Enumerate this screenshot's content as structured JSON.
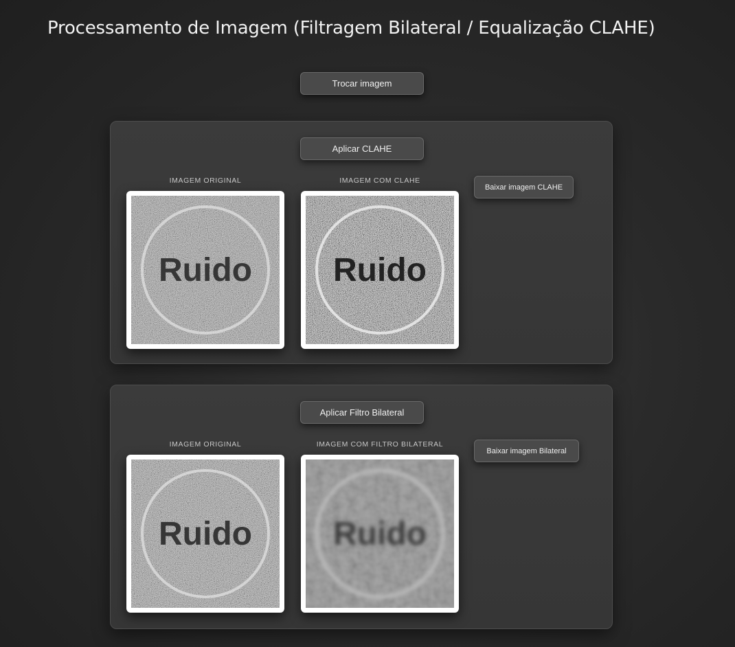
{
  "page": {
    "title": "Processamento de Imagem (Filtragem Bilateral / Equalização CLAHE)"
  },
  "toolbar": {
    "swap_label": "Trocar imagem"
  },
  "clahe_panel": {
    "apply_label": "Aplicar CLAHE",
    "original_label": "IMAGEM ORIGINAL",
    "result_label": "IMAGEM COM CLAHE",
    "download_label": "Baixar imagem CLAHE",
    "image_text": "Ruido"
  },
  "bilateral_panel": {
    "apply_label": "Aplicar Filtro Bilateral",
    "original_label": "IMAGEM ORIGINAL",
    "result_label": "IMAGEM COM FILTRO BILATERAL",
    "download_label": "Baixar imagem Bilateral",
    "image_text": "Ruido"
  },
  "colors": {
    "background": "#222222",
    "panel": "#383838",
    "button": "#4a4a4a"
  }
}
